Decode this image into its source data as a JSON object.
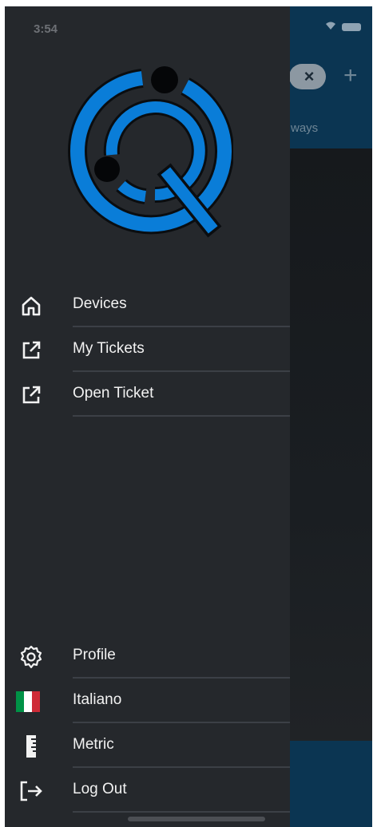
{
  "status_bar": {
    "time": "3:54"
  },
  "background_app": {
    "clear_glyph": "×",
    "add_glyph": "+",
    "tab_partial_label": "ways"
  },
  "drawer": {
    "logo": "q-logo-icon",
    "top_menu": [
      {
        "label": "Devices",
        "icon": "home-icon"
      },
      {
        "label": "My Tickets",
        "icon": "external-link-icon"
      },
      {
        "label": "Open Ticket",
        "icon": "external-link-icon"
      }
    ],
    "bottom_menu": [
      {
        "label": "Profile",
        "icon": "gear-icon"
      },
      {
        "label": "Italiano",
        "icon": "italy-flag-icon"
      },
      {
        "label": "Metric",
        "icon": "ruler-icon"
      },
      {
        "label": "Log Out",
        "icon": "logout-icon"
      }
    ]
  },
  "colors": {
    "drawer_bg": "#25282c",
    "accent_blue": "#0a7dd8",
    "flag": [
      "#009246",
      "#ffffff",
      "#ce2b37"
    ]
  }
}
